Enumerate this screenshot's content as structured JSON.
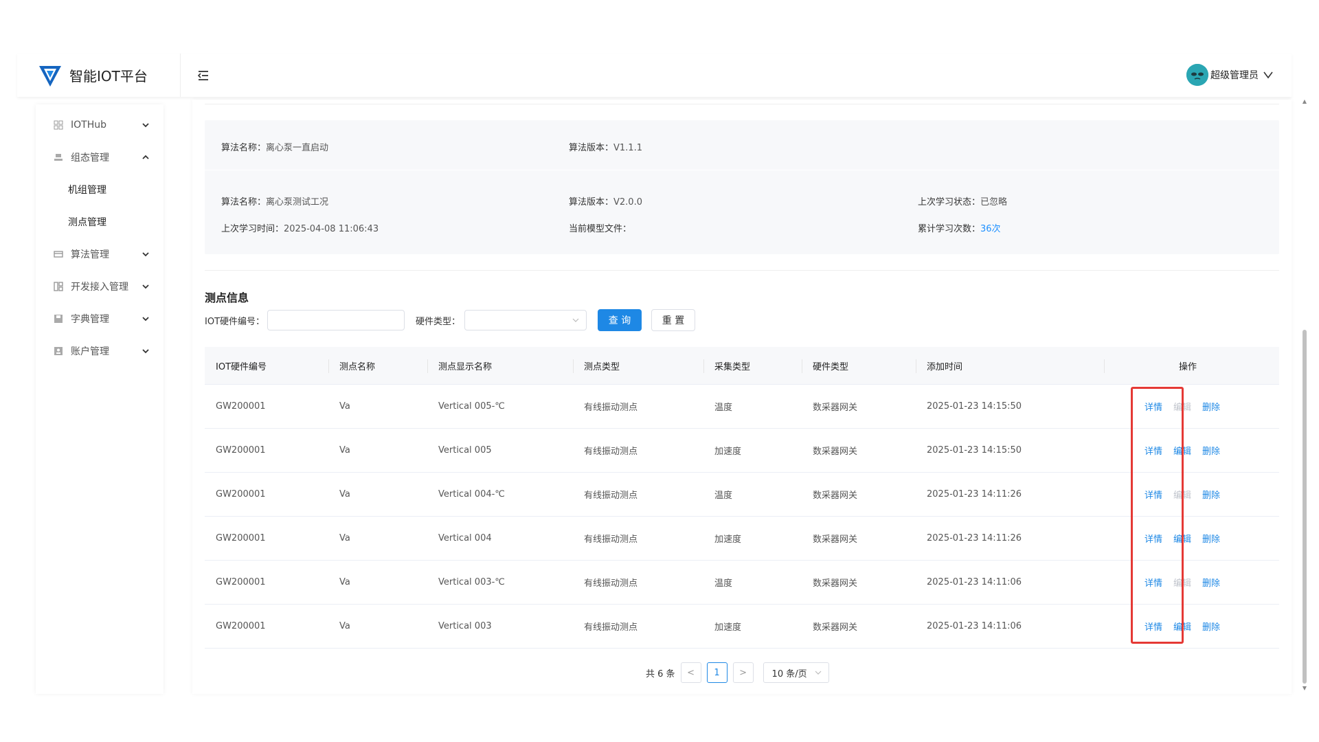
{
  "header": {
    "logo_text": "智能IOT平台",
    "user_name": "超级管理员"
  },
  "sidebar": {
    "items": [
      {
        "label": "IOTHub",
        "icon": "grid-icon",
        "expanded": false
      },
      {
        "label": "组态管理",
        "icon": "layers-icon",
        "expanded": true,
        "children": [
          "机组管理",
          "测点管理"
        ]
      },
      {
        "label": "算法管理",
        "icon": "card-icon",
        "expanded": false
      },
      {
        "label": "开发接入管理",
        "icon": "apps-icon",
        "expanded": false
      },
      {
        "label": "字典管理",
        "icon": "save-icon",
        "expanded": false
      },
      {
        "label": "账户管理",
        "icon": "user-card-icon",
        "expanded": false
      }
    ]
  },
  "algo": {
    "row1": {
      "name_key": "算法名称：",
      "name_val": "离心泵一直启动",
      "ver_key": "算法版本：",
      "ver_val": "V1.1.1"
    },
    "row2": {
      "name_key": "算法名称：",
      "name_val": "离心泵测试工况",
      "ver_key": "算法版本：",
      "ver_val": "V2.0.0",
      "status_key": "上次学习状态：",
      "status_val": "已忽略",
      "time_key": "上次学习时间：",
      "time_val": "2025-04-08 11:06:43",
      "model_key": "当前模型文件：",
      "model_val": "",
      "count_key": "累计学习次数：",
      "count_val": "36次"
    }
  },
  "section": {
    "title": "测点信息"
  },
  "filter": {
    "iot_label": "IOT硬件编号：",
    "hw_label": "硬件类型：",
    "query_label": "查 询",
    "reset_label": "重 置"
  },
  "table": {
    "headers": [
      "IOT硬件编号",
      "测点名称",
      "测点显示名称",
      "测点类型",
      "采集类型",
      "硬件类型",
      "添加时间",
      "操作"
    ],
    "rows": [
      {
        "iot": "GW200001",
        "name": "Va",
        "display": "Vertical 005-℃",
        "type": "有线振动测点",
        "collect": "温度",
        "hw": "数采器网关",
        "time": "2025-01-23 14:15:50",
        "edit_enabled": false
      },
      {
        "iot": "GW200001",
        "name": "Va",
        "display": "Vertical 005",
        "type": "有线振动测点",
        "collect": "加速度",
        "hw": "数采器网关",
        "time": "2025-01-23 14:15:50",
        "edit_enabled": true
      },
      {
        "iot": "GW200001",
        "name": "Va",
        "display": "Vertical 004-℃",
        "type": "有线振动测点",
        "collect": "温度",
        "hw": "数采器网关",
        "time": "2025-01-23 14:11:26",
        "edit_enabled": false
      },
      {
        "iot": "GW200001",
        "name": "Va",
        "display": "Vertical 004",
        "type": "有线振动测点",
        "collect": "加速度",
        "hw": "数采器网关",
        "time": "2025-01-23 14:11:26",
        "edit_enabled": true
      },
      {
        "iot": "GW200001",
        "name": "Va",
        "display": "Vertical 003-℃",
        "type": "有线振动测点",
        "collect": "温度",
        "hw": "数采器网关",
        "time": "2025-01-23 14:11:06",
        "edit_enabled": false
      },
      {
        "iot": "GW200001",
        "name": "Va",
        "display": "Vertical 003",
        "type": "有线振动测点",
        "collect": "加速度",
        "hw": "数采器网关",
        "time": "2025-01-23 14:11:06",
        "edit_enabled": true
      }
    ],
    "op_detail": "详情",
    "op_edit": "编辑",
    "op_delete": "删除"
  },
  "pager": {
    "total": "共 6 条",
    "prev": "<",
    "current": "1",
    "next": ">",
    "size": "10 条/页"
  },
  "colors": {
    "primary": "#1e88e5",
    "highlight": "#e53935",
    "disabled": "#c0c4cc"
  }
}
